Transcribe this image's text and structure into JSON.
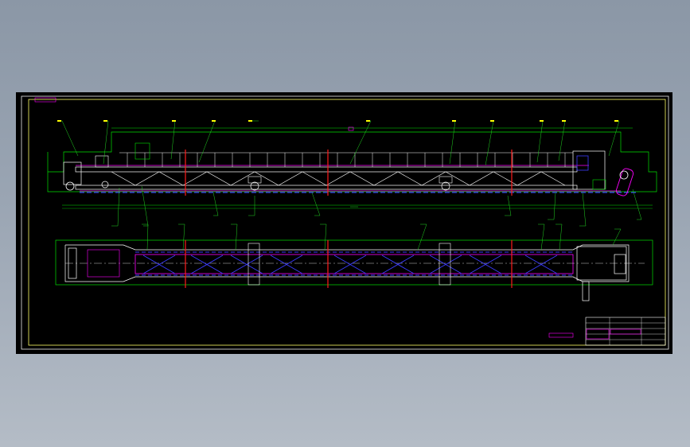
{
  "drawing": {
    "border_tag": "",
    "note_text": "",
    "title_block_rows": [
      "",
      "",
      "",
      ""
    ]
  },
  "colors": {
    "frame": "#f2f2f2",
    "outline": "#00e000",
    "structure": "#ffffff",
    "belt": "#ff00ff",
    "hidden": "#3c3cff",
    "section": "#ff1a1a",
    "leader": "#22d422",
    "callout": "#ffff00",
    "viewport_bg": "#000000"
  },
  "icons": [
    "conveyor-frame",
    "drive-pulley",
    "tail-pulley",
    "motor-reducer"
  ]
}
